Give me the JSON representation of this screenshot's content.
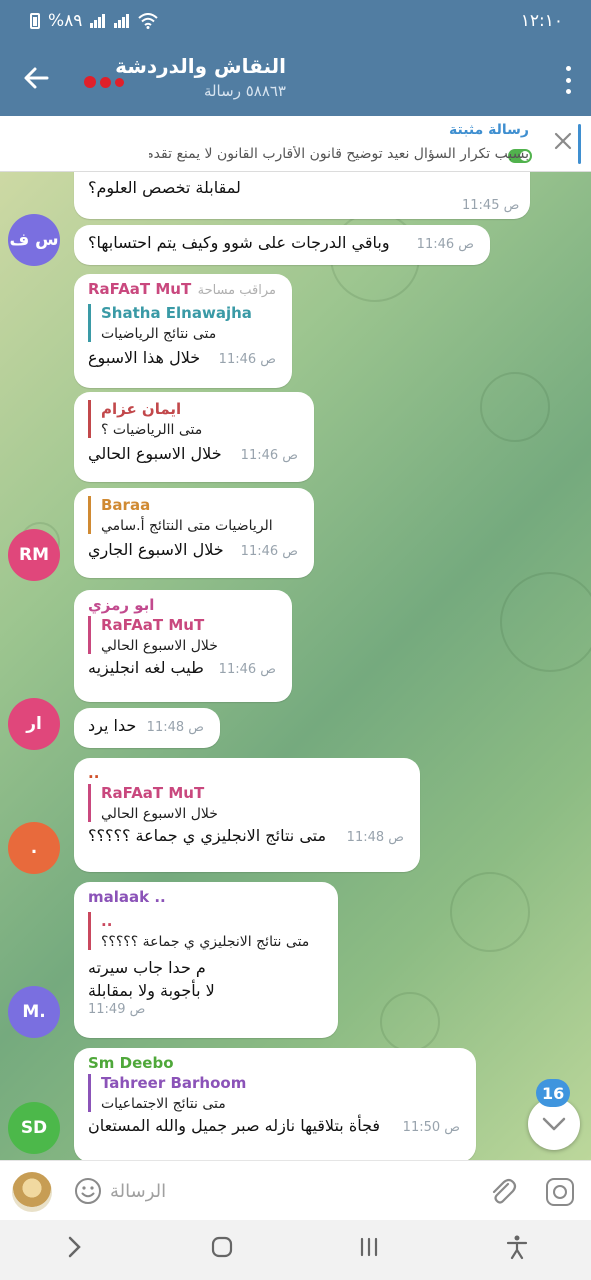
{
  "status_bar": {
    "time": "١٢:١٠",
    "battery": "%٨٩"
  },
  "header": {
    "title": "النقاش والدردشة",
    "subtitle": "٥٨٨٦٣ رسالة"
  },
  "pinned": {
    "label": "رسالة مثبتة",
    "text": "بسبب تكرار السؤال نعيد توضيح قانون الأقارب   القانون لا يمنع تقدم أي أح..."
  },
  "messages": [
    {
      "text": "لمقابلة تخصص العلوم؟",
      "time": "11:45 ص"
    },
    {
      "text": "وباقي الدرجات على شوو وكيف يتم احتسابها؟",
      "time": "11:46 ص"
    },
    {
      "sender": "RaFAaT MuT",
      "role": "مراقب مساحة",
      "reply_name": "Shatha Elnawajha",
      "reply_text": "متى نتائج الرياضيات",
      "text": "خلال هذا الاسبوع",
      "time": "11:46 ص"
    },
    {
      "sender": "ايمان عزام",
      "reply_name": "",
      "reply_text": "متى االرياضيات ؟",
      "text": "خلال الاسبوع الحالي",
      "time": "11:46 ص"
    },
    {
      "sender": "Baraa",
      "reply_name": "",
      "reply_text": "الرياضيات متى النتائج أ.سامي",
      "text": "خلال الاسبوع الجاري",
      "time": "11:46 ص"
    },
    {
      "sender": "ابو رمزي",
      "reply_name": "RaFAaT MuT",
      "reply_text": "خلال الاسبوع الحالي",
      "text": "طيب لغه انجليزيه",
      "time": "11:46 ص"
    },
    {
      "text": "حدا يرد",
      "time": "11:48 ص"
    },
    {
      "sender": "..",
      "reply_name": "RaFAaT MuT",
      "reply_text": "خلال الاسبوع الحالي",
      "text": "متى نتائج الانجليزي ي جماعة ؟؟؟؟؟",
      "time": "11:48 ص"
    },
    {
      "sender": "malaak ..",
      "reply_name": "..",
      "reply_text": "متى نتائج الانجليزي ي جماعة ؟؟؟؟؟",
      "text": "م حدا جاب سيرته",
      "text2": "لا بأجوبة ولا بمقابلة",
      "time": "11:49 ص"
    },
    {
      "sender": "Sm Deebo",
      "reply_name": "Tahreer Barhoom",
      "reply_text": "متى نتائج الاجتماعيات",
      "text": "فجأة بتلاقيها نازله صبر جميل والله المستعان",
      "time": "11:50 ص"
    }
  ],
  "avatars": {
    "sf": "س ف",
    "rm": "RM",
    "ar": "ار",
    "dot": ".",
    "m": "M.",
    "sd": "SD"
  },
  "colors": {
    "header": "#517da2",
    "rafaat": "#c9487e",
    "shatha": "#3a9aa6",
    "eman": "#c2484b",
    "baraa": "#d08a33",
    "aburamzi": "#c24a8e",
    "malaak": "#8b53b8",
    "dots_reply": "#c9485e",
    "smdeebo": "#4fa83a",
    "tahreer": "#8b53b8"
  },
  "unread_count": "16",
  "input": {
    "placeholder": "الرسالة"
  }
}
